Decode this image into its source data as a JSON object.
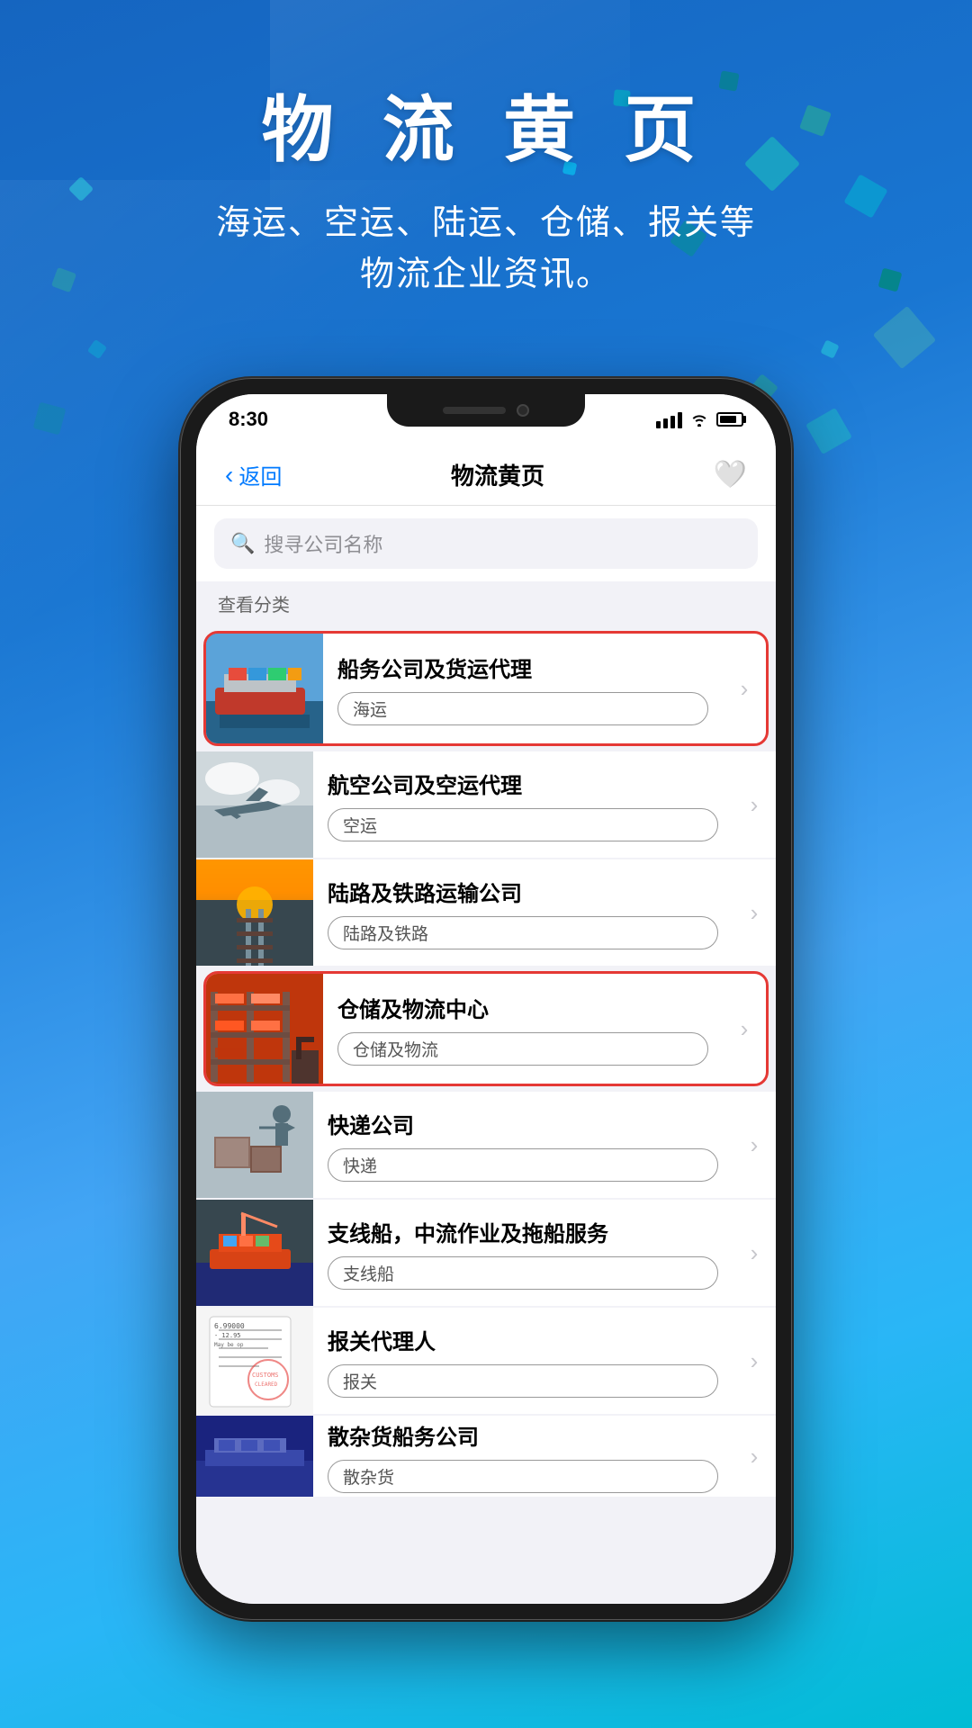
{
  "app": {
    "background": {
      "gradient_start": "#1565c0",
      "gradient_end": "#00bcd4"
    }
  },
  "header": {
    "title": "物 流 黄 页",
    "subtitle_line1": "海运、空运、陆运、仓储、报关等",
    "subtitle_line2": "物流企业资讯。"
  },
  "phone": {
    "status_bar": {
      "time": "8:30"
    },
    "nav_bar": {
      "back_label": "返回",
      "title": "物流黄页",
      "heart_icon": "♡"
    },
    "search": {
      "placeholder": "搜寻公司名称"
    },
    "category_label": "查看分类",
    "list_items": [
      {
        "id": "shipping",
        "title": "船务公司及货运代理",
        "tag": "海运",
        "highlighted": true,
        "image_type": "ship"
      },
      {
        "id": "airline",
        "title": "航空公司及空运代理",
        "tag": "空运",
        "highlighted": false,
        "image_type": "plane"
      },
      {
        "id": "road",
        "title": "陆路及铁路运输公司",
        "tag": "陆路及铁路",
        "highlighted": false,
        "image_type": "railway"
      },
      {
        "id": "warehouse",
        "title": "仓储及物流中心",
        "tag": "仓储及物流",
        "highlighted": true,
        "image_type": "warehouse"
      },
      {
        "id": "courier",
        "title": "快递公司",
        "tag": "快递",
        "highlighted": false,
        "image_type": "courier"
      },
      {
        "id": "vessel",
        "title": "支线船，中流作业及拖船服务",
        "tag": "支线船",
        "highlighted": false,
        "image_type": "vessel"
      },
      {
        "id": "customs",
        "title": "报关代理人",
        "tag": "报关",
        "highlighted": false,
        "image_type": "customs",
        "customs_text": "6.99000 - 12.95\nMay be op"
      },
      {
        "id": "bulk",
        "title": "散杂货船务公司",
        "tag": "散杂货",
        "highlighted": false,
        "image_type": "bulk"
      }
    ]
  }
}
